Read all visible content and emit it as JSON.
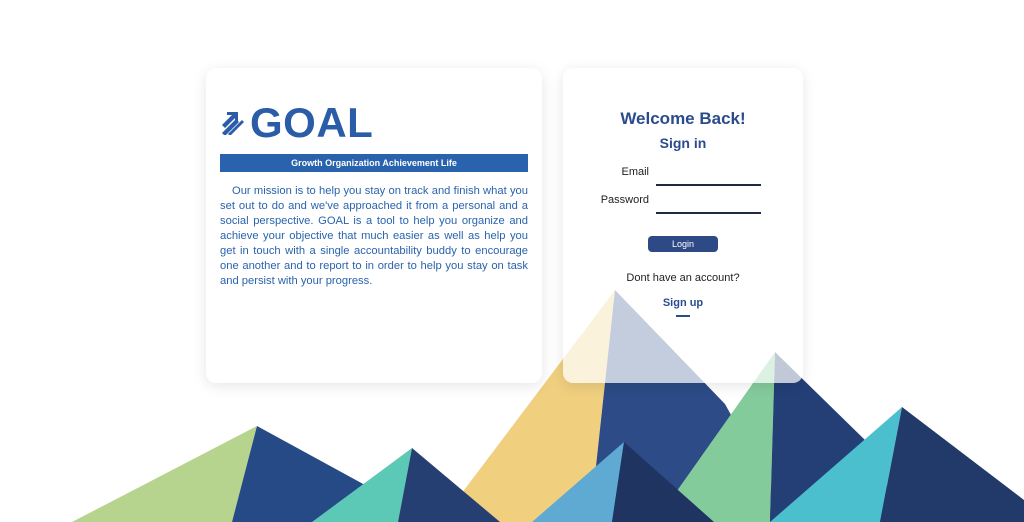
{
  "brand": {
    "logo_text": "GOAL",
    "tagline": "Growth Organization Achievement Life",
    "mission": "Our mission is to help you stay on track and finish what you set out to do and we've approached it from a personal and a social perspective. GOAL is a tool to help you organize and achieve your objective that much easier as well as help you get in touch with a single accountability buddy to encourage one another and to report to in order to help you stay on task and persist with your progress.",
    "logo_icon": "arrow-up-right-icon"
  },
  "signin": {
    "welcome": "Welcome Back!",
    "title": "Sign in",
    "email_label": "Email",
    "email_value": "",
    "password_label": "Password",
    "password_value": "",
    "login_label": "Login",
    "no_account_text": "Dont have an account?",
    "signup_label": "Sign up"
  },
  "colors": {
    "brand_blue": "#2a63ad",
    "heading_navy": "#2a4c8c",
    "button_navy": "#2e4a86",
    "mountain_yellow": "#f0cf7f",
    "mountain_navy": "#2c4b87",
    "mountain_green": "#84cb9c",
    "mountain_teal": "#4cbfcf",
    "mountain_lime": "#b7d48f"
  }
}
